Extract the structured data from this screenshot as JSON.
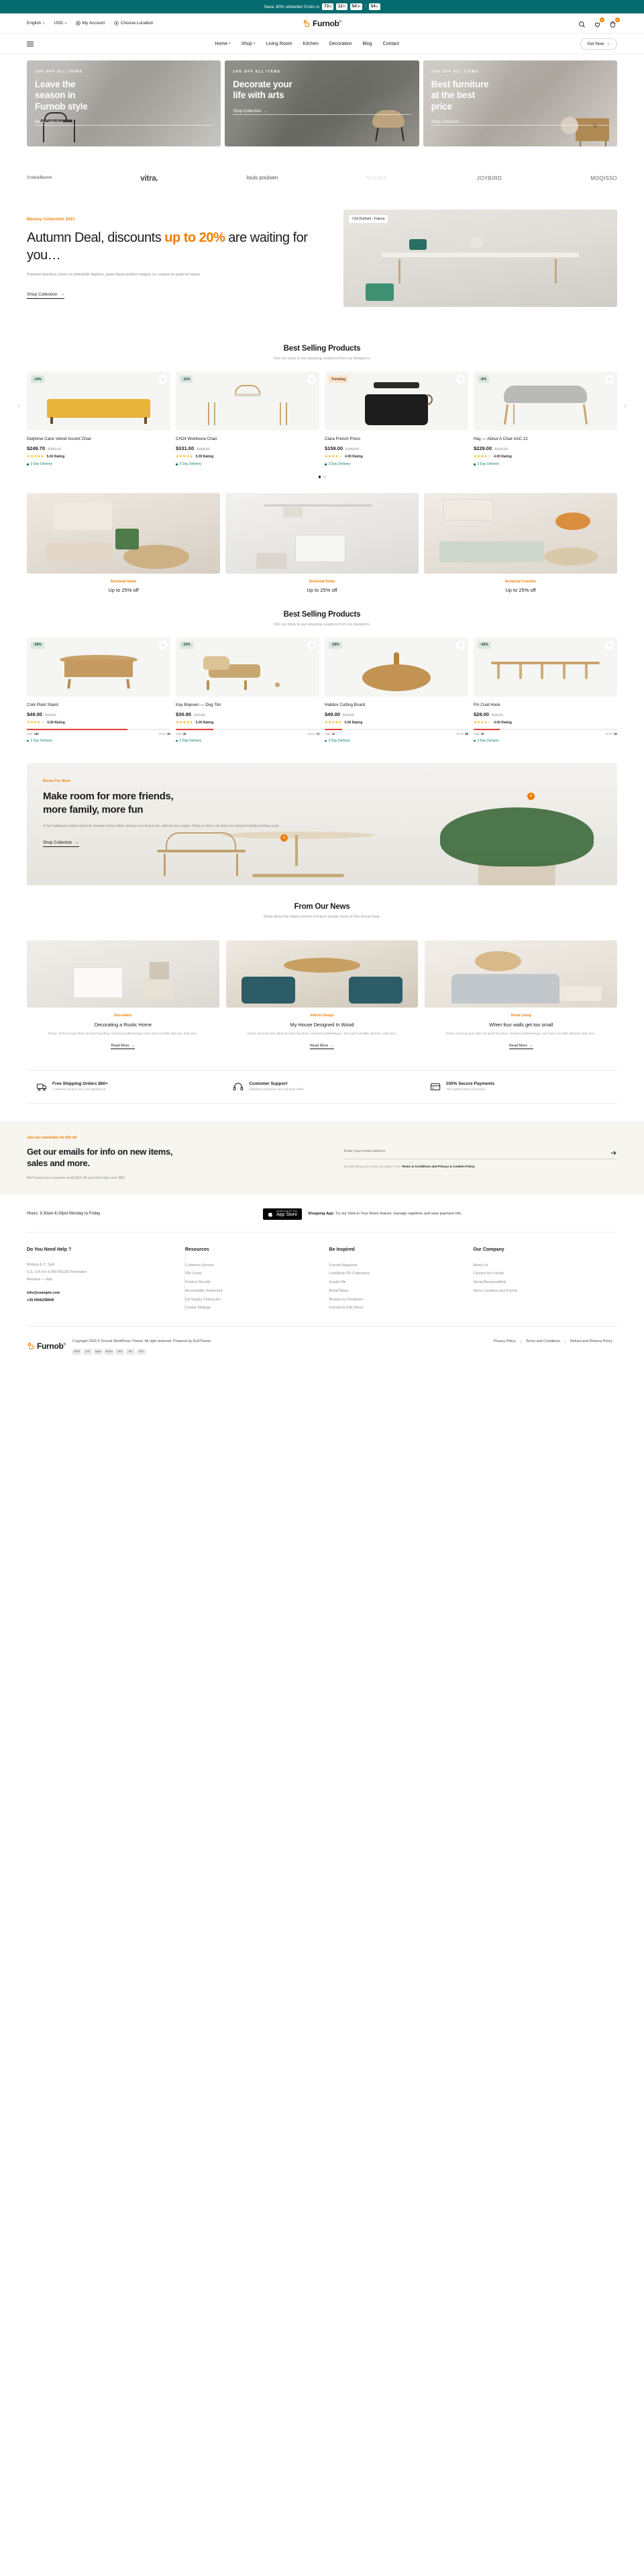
{
  "announcement": {
    "text": "Save 30% sitewide! Ends in",
    "countdown": [
      {
        "value": "73",
        "unit": "d"
      },
      {
        "value": "12",
        "unit": "h"
      },
      {
        "value": "54",
        "unit": "m"
      },
      {
        "value": "54",
        "unit": "s"
      }
    ],
    "separator": ":",
    "bg": "#066b6f"
  },
  "utility": {
    "language": "English",
    "currency": "USD",
    "account": "My Account",
    "location": "Choose Location",
    "logo": "Furnob",
    "logo_sup": "®",
    "wishlist_count": "0",
    "cart_count": "0"
  },
  "nav": {
    "items": [
      {
        "label": "Home",
        "caret": true
      },
      {
        "label": "Shop",
        "caret": true
      },
      {
        "label": "Living Room",
        "caret": false
      },
      {
        "label": "Kitchen",
        "caret": false
      },
      {
        "label": "Decoration",
        "caret": false
      },
      {
        "label": "Blog",
        "caret": false
      },
      {
        "label": "Contact",
        "caret": false
      }
    ],
    "cta": "Get Now"
  },
  "hero": [
    {
      "kicker": "10% OFF ALL ITEMS",
      "title": "Leave the\nseason in\nFurnob style",
      "cta": "Shop Collection"
    },
    {
      "kicker": "10% OFF ALL ITEMS",
      "title": "Decorate your\nlife with arts",
      "cta": "Shop Collection"
    },
    {
      "kicker": "10% OFF ALL ITEMS",
      "title": "Best furniture\nat the best\nprice",
      "cta": "Shop Collection"
    }
  ],
  "brands": [
    "Crate&Barrel",
    "vitra.",
    "louis poulsen",
    "NICHE",
    "JOYBIRD",
    "MOQISSO"
  ],
  "deal": {
    "kicker": "Massey Collection 2021",
    "title_a": "Autumn Deal, discounts ",
    "title_b": "up to 20%",
    "title_c": " are waiting for you…",
    "sub": "Praesent faucibus, lorem ut sollicitudin dapibus, quam ligula pretium magna, eu congue ex quam id neque.",
    "cta": "Shop Collection",
    "image_tag": "Clot Durham - Franca"
  },
  "section_best_1": {
    "title": "Best Selling Products",
    "sub": "Visit our shop to see amazing creations from our designers."
  },
  "products_1": [
    {
      "badge": "-14%",
      "badge_type": "discount",
      "name": "Delphine Cane Velvet Accent Chair",
      "price": "$249.70",
      "old_price": "$289.70",
      "stars": 5,
      "rating": "5.00 Rating",
      "shipping": "3 Day Delivery"
    },
    {
      "badge": "-11%",
      "badge_type": "discount",
      "name": "CH24 Wishbone Chair",
      "price": "$331.00",
      "old_price": "$368.00",
      "stars": 5,
      "rating": "5.00 Rating",
      "shipping": "3 Day Delivery"
    },
    {
      "badge": "Trending",
      "badge_type": "trending",
      "name": "Clara French Press",
      "price": "$159.00",
      "old_price": "$189.00",
      "stars": 4,
      "rating": "4.00 Rating",
      "shipping": "3 Day Delivery"
    },
    {
      "badge": "-9%",
      "badge_type": "discount",
      "name": "Hay — About A Chair AAC 22",
      "price": "$229.00",
      "old_price": "$249.00",
      "stars": 4,
      "rating": "4.00 Rating",
      "shipping": "3 Day Delivery"
    }
  ],
  "categories": [
    {
      "kicker": "Sectional Sofas",
      "title": "Up to 25% off"
    },
    {
      "kicker": "Sectional Sofas",
      "title": "Up to 25% off"
    },
    {
      "kicker": "Sectional Couches",
      "title": "Up to 25% off"
    }
  ],
  "section_best_2": {
    "title": "Best Selling Products",
    "sub": "Visit our shop to see amazing creations from our designers."
  },
  "products_2": [
    {
      "badge": "-29%",
      "badge_type": "discount",
      "name": "Cork Plant Stand",
      "price": "$49.00",
      "old_price": "$69.00",
      "stars": 4,
      "rating": "4.00 Rating",
      "shipping": "3 Day Delivery",
      "sold_label": "Sold:",
      "sold": "140",
      "stock_label": "Stock:",
      "stock": "60",
      "bar_pct": 70
    },
    {
      "badge": "-32%",
      "badge_type": "discount",
      "name": "Kay Bojesen — Dog Tim",
      "price": "$30.95",
      "old_price": "$45.95",
      "stars": 5,
      "rating": "5.00 Rating",
      "shipping": "3 Day Delivery",
      "sold_label": "Sold:",
      "sold": "26",
      "stock_label": "Stock:",
      "stock": "74",
      "bar_pct": 26
    },
    {
      "badge": "-29%",
      "badge_type": "discount",
      "name": "Halldox Cutting Board",
      "price": "$49.00",
      "old_price": "$69.00",
      "stars": 5,
      "rating": "5.00 Rating",
      "shipping": "3 Day Delivery",
      "sold_label": "Sold:",
      "sold": "12",
      "stock_label": "Stock:",
      "stock": "88",
      "bar_pct": 12
    },
    {
      "badge": "-42%",
      "badge_type": "discount",
      "name": "Fin Coat Hook",
      "price": "$28.00",
      "old_price": "$48.00",
      "stars": 4,
      "rating": "4.00 Rating",
      "shipping": "3 Day Delivery",
      "sold_label": "Sold:",
      "sold": "18",
      "stock_label": "Stock:",
      "stock": "82",
      "bar_pct": 18
    }
  ],
  "wide_banner": {
    "kicker": "Room For More",
    "title": "Make room for more friends,\nmore family, more fun",
    "sub": "In fac habitasse platea dictumst. Aenean lectus diam, tempus nec lectus vel, ultricies non augue. Nulla ac libero sit amet orci laoreet lobortis tristique quis.",
    "cta": "Shop Collection"
  },
  "news_section": {
    "title": "From Our News",
    "sub": "Read about the latest modern furniture design news on the furnob blog."
  },
  "news": [
    {
      "kicker": "Decoration",
      "title": "Decorating a Rustic Home",
      "sub": "Donec rhoncus quis diam sit amet faucibus. Vivamus pellentesque, sem sed convallis ultricies, ante arcu.",
      "more": "Read More"
    },
    {
      "kicker": "Interior Design",
      "title": "My House Designed In Wood",
      "sub": "Donec rhoncus quis diam sit amet faucibus. Vivamus pellentesque, sem sed convallis ultricies, ante arcu.",
      "more": "Read More"
    },
    {
      "kicker": "Home Living",
      "title": "When four walls get too small",
      "sub": "Donec rhoncus quis diam sit amet faucibus. Vivamus pellentesque, sem sed convallis ultricies, ante arcu.",
      "more": "Read More"
    }
  ],
  "services": [
    {
      "icon": "truck-icon",
      "title": "Free Shipping Orders $60+",
      "sub": "A delivery service you can depend on"
    },
    {
      "icon": "headset-icon",
      "title": "Customer Support",
      "sub": "Satisfied customers are our best seller"
    },
    {
      "icon": "card-icon",
      "title": "100% Secure Payments",
      "sub": "The highest kind of security"
    }
  ],
  "newsletter": {
    "kicker": "Join our newsletter for $10 off",
    "title": "Get our emails for info on new items,\nsales and more.",
    "sub": "We'll send you a voucher worth $10 off your first order over $50.",
    "placeholder": "Enter your email address",
    "terms_pre": "By submitting your email you agree to the ",
    "terms_link": "Terms & Conditions and Privacy & Cookies Policy",
    "terms_post": "."
  },
  "footer": {
    "hours": "Hours: 9.30am-6.30pm Monday to Friday",
    "appstore_small": "DOWNLOAD ON THE",
    "appstore_big": "App Store",
    "app_label": "Shopping App:",
    "app_text": " Try our View in Your Room feature, manage registries and save payment info.",
    "columns": [
      {
        "title": "Do You Need Help ?",
        "lines": [
          "Mollura & C. SpA",
          "S.S. 114 Km 6,400 98128 Tremestieri",
          "Messina — Italy"
        ],
        "contacts": [
          "info@example.com",
          "+39 0906258945"
        ]
      },
      {
        "title": "Resources",
        "links": [
          "Customer Service",
          "Gift Cards",
          "Product Recalls",
          "Accessibility Statement",
          "CA Supply Chains Act",
          "Cookie Settings"
        ]
      },
      {
        "title": "Be Inspired",
        "links": [
          "Furnob Magazine",
          "LookBook FR Collections",
          "Inspire Me",
          "Brand News",
          "Browse by Designers",
          "Furnob for Elle Decor"
        ]
      },
      {
        "title": "Our Company",
        "links": [
          "About Us",
          "Careers for Furnob",
          "Social Responsibility",
          "Store Locations and Events"
        ]
      }
    ],
    "logo": "Furnob",
    "logo_sup": "®",
    "copyright": "Copyright 2023 © Furnob WordPress Theme. All right reserved. Powered by KLBTheme.",
    "payments": [
      "AMEX",
      "JCB",
      "Apple",
      "PayPal",
      "VISA",
      "MC",
      "DISC"
    ],
    "policy_links": [
      "Privacy Policy",
      "Terms and Conditions",
      "Refund and Returns Policy"
    ]
  }
}
